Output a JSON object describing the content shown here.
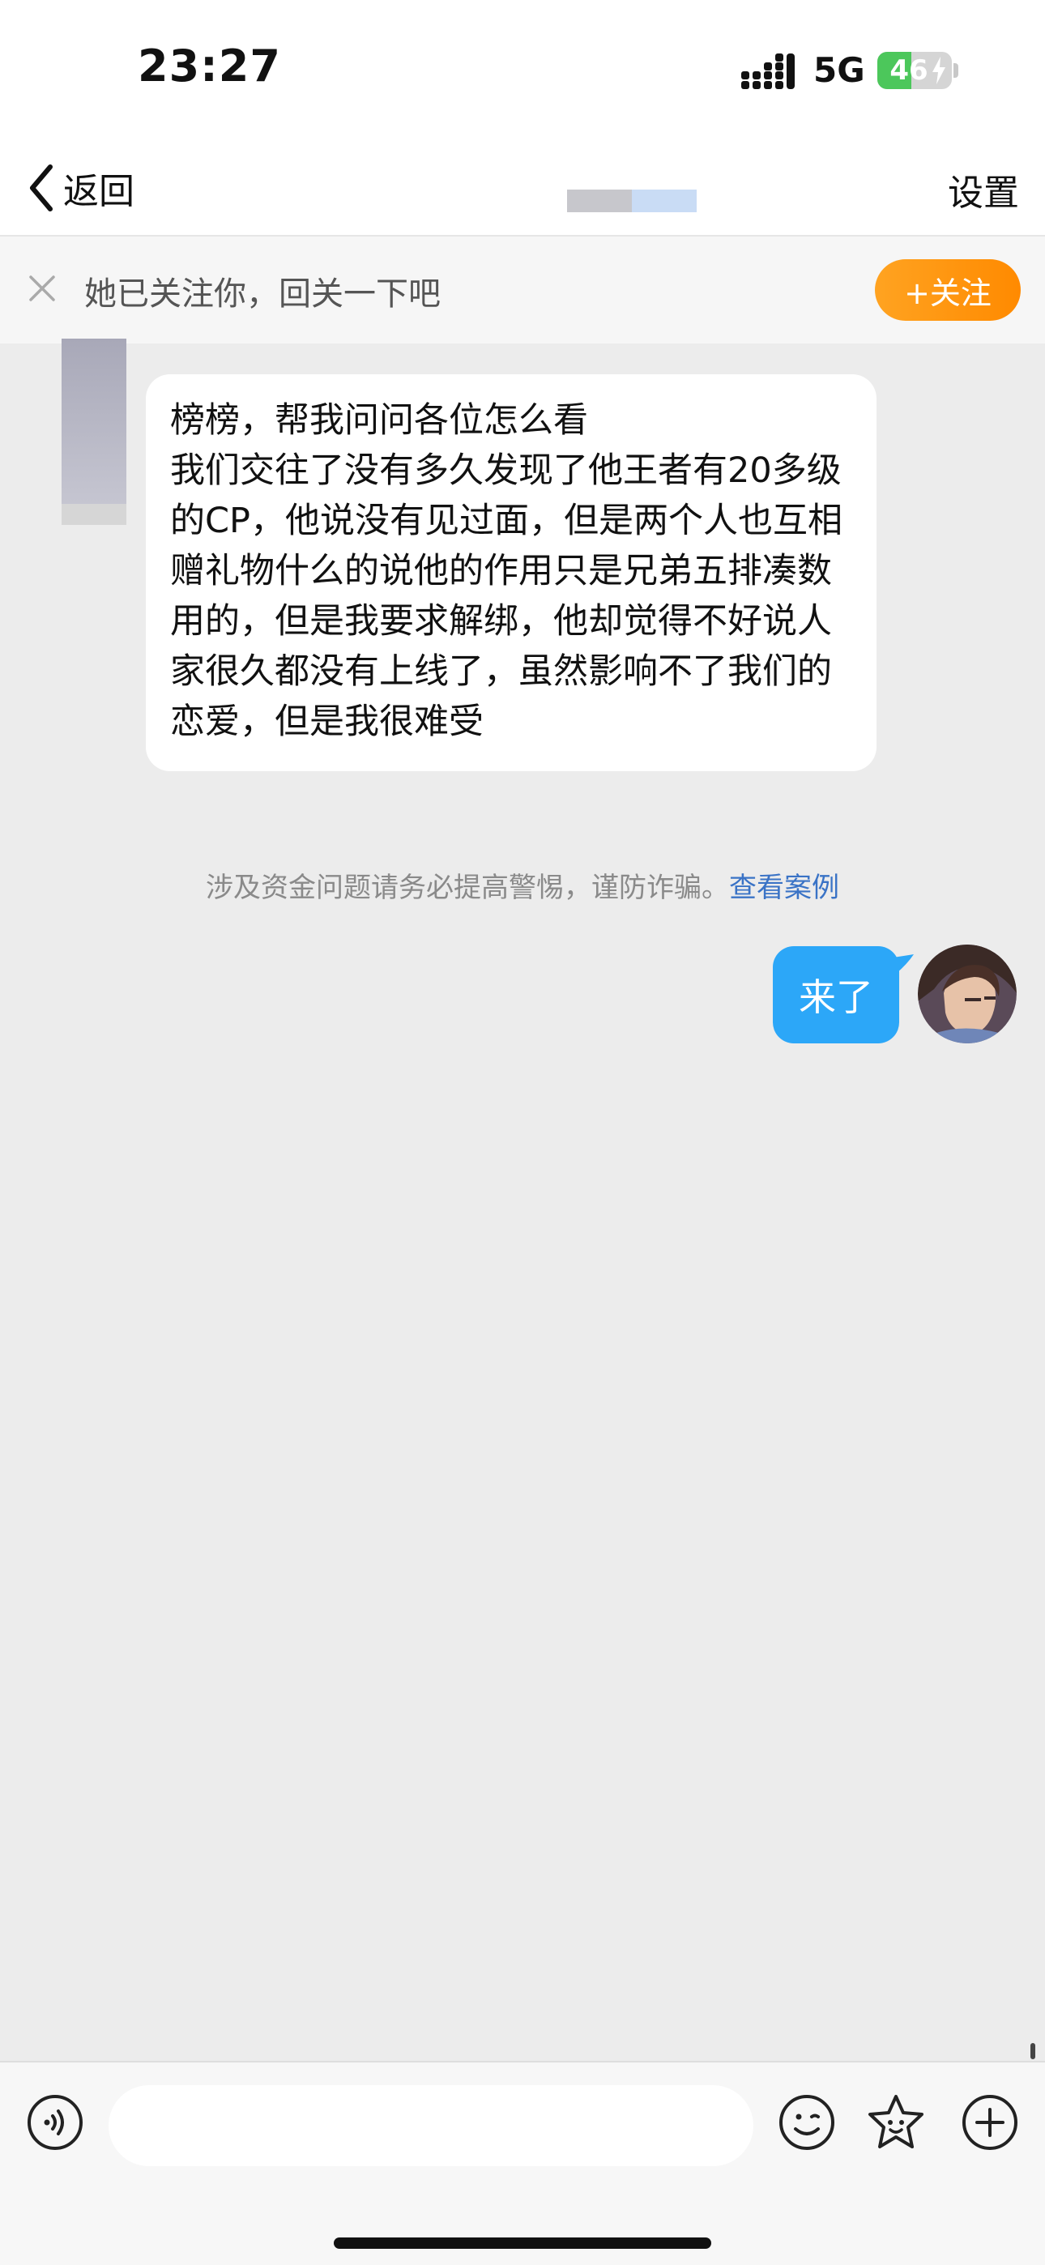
{
  "status_bar": {
    "time": "23:27",
    "network": "5G",
    "battery": "46",
    "battery_level": 0.46
  },
  "nav": {
    "back_label": "返回",
    "settings_label": "设置"
  },
  "follow_banner": {
    "text": "她已关注你，回关一下吧",
    "button_label": "+关注"
  },
  "messages": {
    "incoming": "榜榜，帮我问问各位怎么看\n我们交往了没有多久发现了他王者有20多级的CP，他说没有见过面，但是两个人也互相赠礼物什么的说他的作用只是兄弟五排凑数用的，但是我要求解绑，他却觉得不好说人家很久都没有上线了，虽然影响不了我们的恋爱，但是我很难受",
    "outgoing": "来了"
  },
  "warning": {
    "text": "涉及资金问题请务必提高警惕，谨防诈骗。",
    "link": "查看案例"
  },
  "input_bar": {
    "placeholder": ""
  },
  "colors": {
    "accent_blue": "#2ca7f8",
    "follow_orange": "#ff9a0f",
    "link_blue": "#3a73c6",
    "battery_green": "#4cc75b"
  },
  "icons": [
    "back-chevron-icon",
    "close-icon",
    "voice-icon",
    "emoji-icon",
    "sticker-icon",
    "plus-icon",
    "signal-icon",
    "battery-icon"
  ]
}
